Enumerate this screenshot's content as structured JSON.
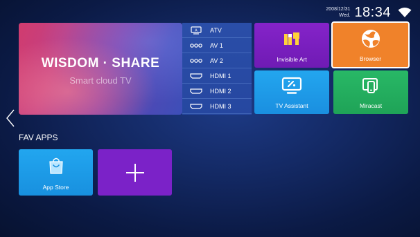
{
  "status": {
    "date": "2008/12/31",
    "day": "Wed.",
    "time": "18:34",
    "wifi_icon": "wifi-icon"
  },
  "banner": {
    "title": "WISDOM · SHARE",
    "subtitle": "Smart cloud TV"
  },
  "sources": [
    {
      "label": "ATV",
      "icon": "antenna-tv-icon"
    },
    {
      "label": "AV 1",
      "icon": "av-connector-icon"
    },
    {
      "label": "AV 2",
      "icon": "av-connector-icon"
    },
    {
      "label": "HDMI 1",
      "icon": "hdmi-icon"
    },
    {
      "label": "HDMI 2",
      "icon": "hdmi-icon"
    },
    {
      "label": "HDMI 3",
      "icon": "hdmi-icon"
    }
  ],
  "tiles": {
    "invisible_art": "Invisible Art",
    "browser": "Browser",
    "tv_assistant": "TV Assistant",
    "miracast": "Miracast"
  },
  "fav": {
    "title": "FAV APPS",
    "app_store": "App Store"
  },
  "colors": {
    "invisible_art": "#7d20c0",
    "browser": "#f0822a",
    "tv_assistant": "#1f9bea",
    "miracast": "#24ad5e",
    "app_store": "#1d9be7",
    "add": "#7b22c8"
  }
}
